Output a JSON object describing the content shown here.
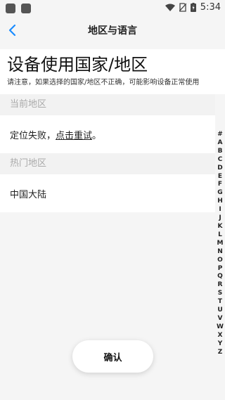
{
  "status_bar": {
    "time": "5:34"
  },
  "nav": {
    "title": "地区与语言"
  },
  "header": {
    "heading": "设备使用国家/地区",
    "hint": "请注意，如果选择的国家/地区不正确，可能影响设备正常使用"
  },
  "current_region": {
    "section_label": "当前地区",
    "status_prefix": "定位失败，",
    "retry_label": "点击重试",
    "status_suffix": "。"
  },
  "hot_regions": {
    "section_label": "热门地区",
    "items": [
      {
        "label": "中国大陆"
      }
    ]
  },
  "index_letters": [
    "#",
    "A",
    "B",
    "C",
    "D",
    "E",
    "F",
    "G",
    "H",
    "I",
    "J",
    "K",
    "L",
    "M",
    "N",
    "O",
    "P",
    "Q",
    "R",
    "S",
    "T",
    "U",
    "V",
    "W",
    "X",
    "Y",
    "Z"
  ],
  "confirm_button": {
    "label": "确认"
  },
  "colors": {
    "accent": "#1a8cff",
    "background": "#f5f5f5"
  }
}
